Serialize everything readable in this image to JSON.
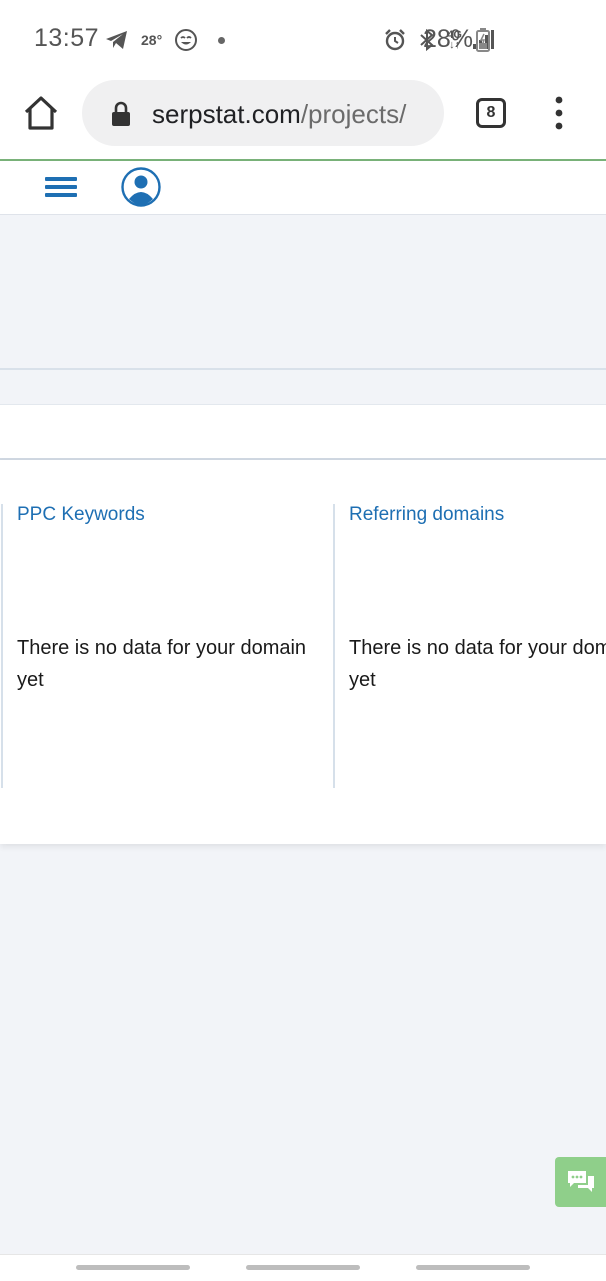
{
  "status_bar": {
    "time": "13:57",
    "temperature": "28°",
    "network": "4G",
    "battery": "28%",
    "icons": [
      "telegram-icon",
      "emoji-icon",
      "alarm-icon",
      "bluetooth-icon",
      "signal-icon",
      "battery-icon"
    ]
  },
  "browser": {
    "url_domain": "serpstat.com",
    "url_path": "/projects/",
    "tab_count": "8"
  },
  "header": {
    "icons": [
      "hamburger-menu-icon",
      "user-avatar-icon"
    ]
  },
  "cards": [
    {
      "title": "PPC Keywords",
      "empty_message": "There is no data for your domain yet"
    },
    {
      "title": "Referring domains",
      "empty_message": "There is no data for your domain yet"
    }
  ],
  "colors": {
    "accent": "#1e6fb3",
    "chat_widget": "#8fcf8a",
    "page_bg": "#f2f4f8"
  }
}
